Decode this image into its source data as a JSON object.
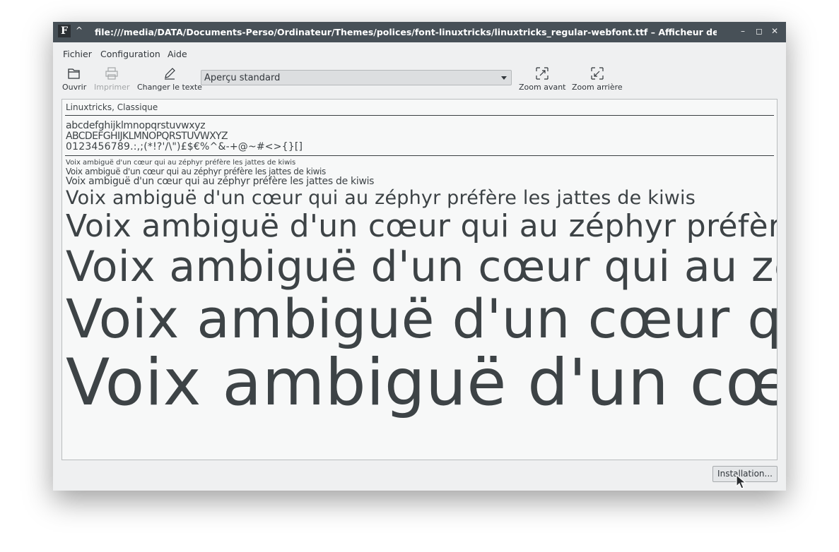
{
  "window": {
    "title": "file:///media/DATA/Documents-Perso/Ordinateur/Themes/polices/font-linuxtricks/linuxtricks_regular-webfont.ttf – Afficheur de polices",
    "keep_above_glyph": "^",
    "minimize_glyph": "–",
    "maximize_glyph": "◻",
    "close_glyph": "✕"
  },
  "menu": {
    "file": "Fichier",
    "configuration": "Configuration",
    "help": "Aide"
  },
  "toolbar": {
    "open": "Ouvrir",
    "print": "Imprimer",
    "change_text": "Changer le texte",
    "preview_mode": "Aperçu standard",
    "zoom_in": "Zoom avant",
    "zoom_out": "Zoom arrière"
  },
  "preview": {
    "font_name": "Linuxtricks, Classique",
    "lowercase": "abcdefghijklmnopqrstuvwxyz",
    "uppercase": "ABCDEFGHIJKLMNOPQRSTUVWXYZ",
    "symbols": "0123456789.:,;(*!?'/\\\")£$€%^&-+@~#<>{}[]",
    "sample": "Voix ambiguë d'un cœur qui au zéphyr préfère les jattes de kiwis"
  },
  "buttons": {
    "install": "Installation..."
  }
}
